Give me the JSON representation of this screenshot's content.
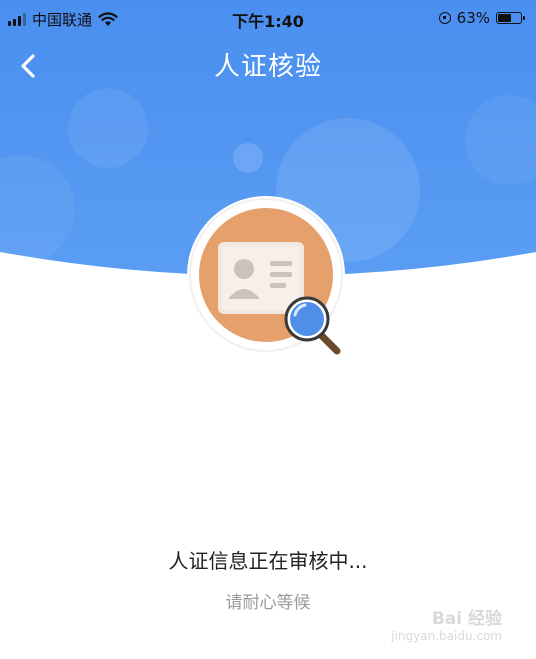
{
  "status_bar": {
    "carrier": "中国联通",
    "time": "下午1:40",
    "battery_percent_label": "63%",
    "battery_level": 0.63,
    "icons": [
      "signal-icon",
      "wifi-icon",
      "rotation-lock-icon",
      "battery-icon"
    ]
  },
  "nav": {
    "back_icon": "chevron-left-icon",
    "title": "人证核验"
  },
  "illustration": {
    "icon": "id-card-verify-icon",
    "magnifier_icon": "magnifier-icon"
  },
  "message": {
    "title": "人证信息正在审核中...",
    "subtitle": "请耐心等候"
  },
  "watermark": {
    "brand": "Bai 经验",
    "url": "jingyan.baidu.com"
  },
  "colors": {
    "header_blue": "#4f95f1",
    "badge_orange": "#e6a06c",
    "magnifier_lens": "#4f8fe8",
    "magnifier_handle": "#6b4a2b"
  }
}
